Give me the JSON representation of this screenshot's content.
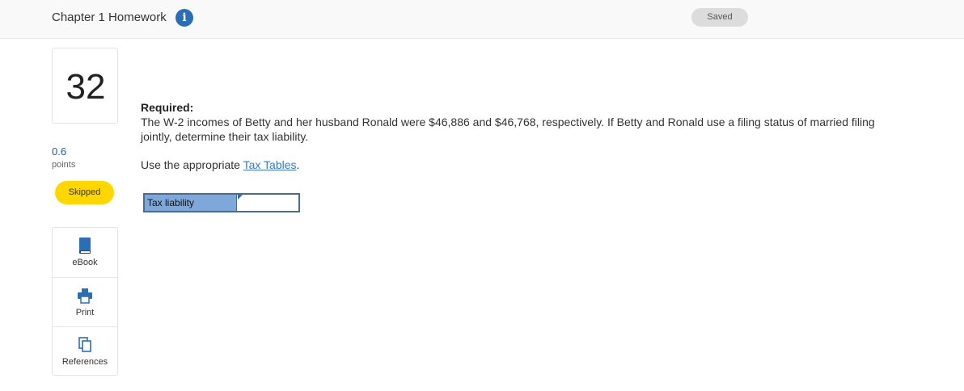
{
  "header": {
    "title": "Chapter 1 Homework",
    "info_icon": "info-icon",
    "saved_label": "Saved"
  },
  "question": {
    "number": "32",
    "points_value": "0.6",
    "points_label": "points",
    "status": "Skipped"
  },
  "tools": [
    {
      "label": "eBook",
      "icon": "book-icon"
    },
    {
      "label": "Print",
      "icon": "printer-icon"
    },
    {
      "label": "References",
      "icon": "copy-icon"
    }
  ],
  "content": {
    "required_heading": "Required:",
    "required_text": "The W-2 incomes of Betty and her husband Ronald were $46,886 and $46,768, respectively. If Betty and Ronald use a filing status of married filing jointly, determine their tax liability.",
    "use_prefix": "Use the appropriate ",
    "use_link": "Tax Tables",
    "use_suffix": "."
  },
  "answer": {
    "label": "Tax liability",
    "value": ""
  },
  "colors": {
    "accent_blue": "#2c6eb5",
    "skipped_yellow": "#ffd700",
    "label_cell": "#7fa7d9"
  }
}
